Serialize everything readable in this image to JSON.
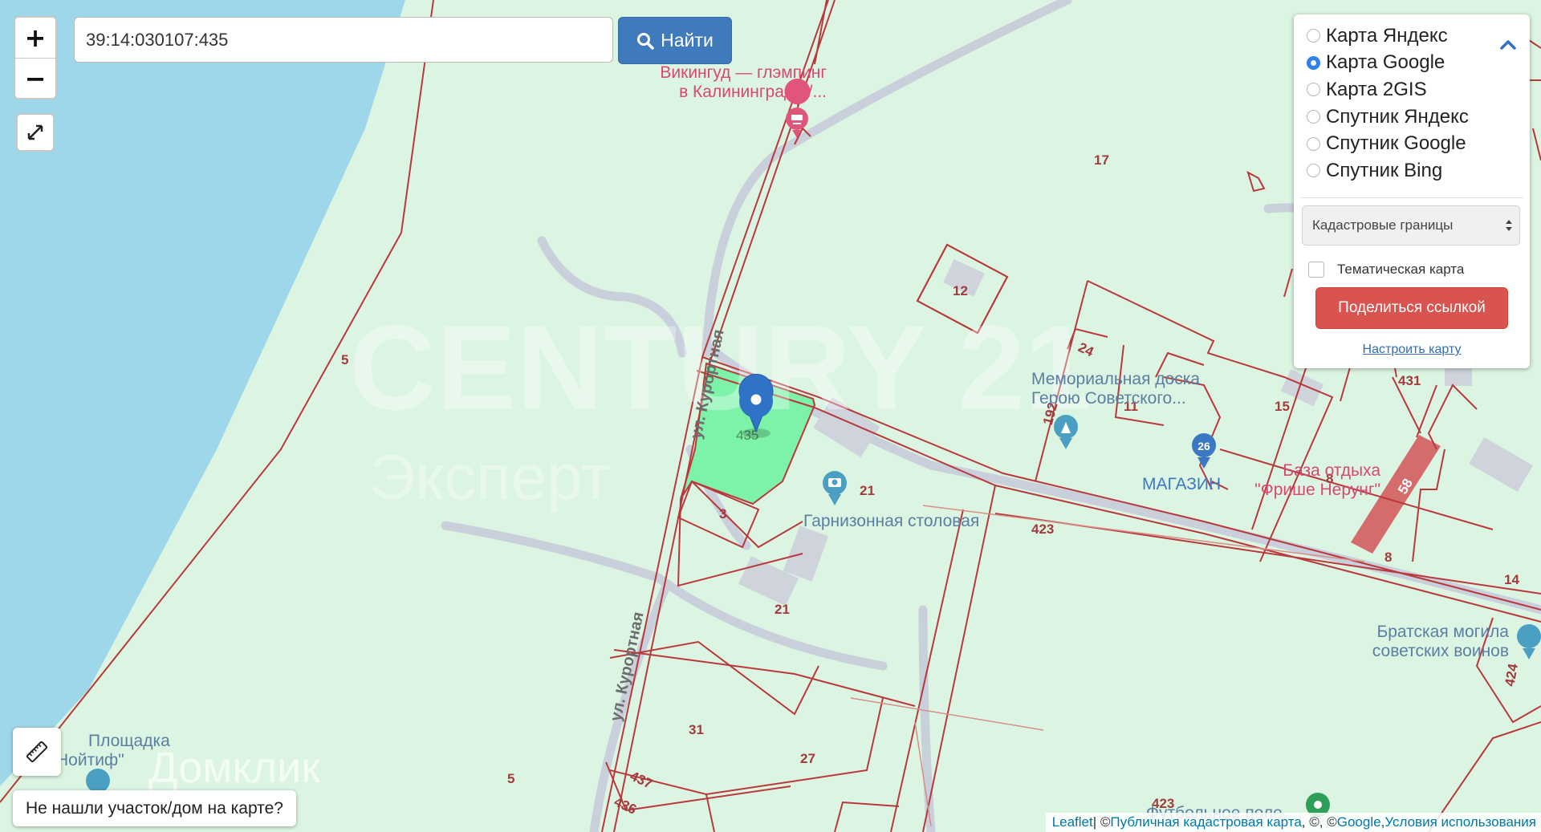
{
  "search": {
    "value": "39:14:030107:435",
    "button_label": "Найти"
  },
  "zoom": {
    "in_label": "+",
    "out_label": "−"
  },
  "layers": {
    "items": [
      {
        "label": "Карта Яндекс",
        "selected": false
      },
      {
        "label": "Карта Google",
        "selected": true
      },
      {
        "label": "Карта 2GIS",
        "selected": false
      },
      {
        "label": "Спутник Яндекс",
        "selected": false
      },
      {
        "label": "Спутник Google",
        "selected": false
      },
      {
        "label": "Спутник Bing",
        "selected": false
      }
    ],
    "overlay_select": "Кадастровые границы",
    "thematic_label": "Тематическая карта",
    "share_label": "Поделиться ссылкой",
    "configure_label": "Настроить карту"
  },
  "not_found_label": "Не нашли участок/дом на карте?",
  "attribution": {
    "leaflet": "Leaflet",
    "sep1": " | © ",
    "cadastral": "Публичная кадастровая карта",
    "sep2": ", ©, © ",
    "google": "Google",
    "sep3": ", ",
    "terms": "Условия использования"
  },
  "map": {
    "watermarks": [
      "CENTURY 21",
      "Эксперт",
      "Домклик"
    ],
    "parcel_numbers": [
      "5",
      "17",
      "12",
      "24",
      "11",
      "192",
      "26",
      "15",
      "431",
      "58",
      "8",
      "21",
      "3",
      "423",
      "21",
      "8",
      "14",
      "424",
      "31",
      "27",
      "437",
      "436",
      "5",
      "423",
      "435"
    ],
    "street_labels": [
      "ул. Курортная",
      "ул. Курортная"
    ],
    "poi": {
      "glamping": [
        "Викингуд — глэмпинг",
        "в Калининграде /..."
      ],
      "memorial": [
        "Мемориальная доска",
        "Герою Советского..."
      ],
      "shop": "МАГАЗИН",
      "resort": [
        "База отдыха",
        "\"Фрише Нерунг\""
      ],
      "canteen": "Гарнизонная столовая",
      "grave": [
        "Братская могила",
        "советских воинов"
      ],
      "playground": [
        "Площадка",
        "Нойтиф\""
      ],
      "football": "Футбольное поле"
    },
    "colors": {
      "water": "#9fd7ea",
      "land": "#dcf5e2",
      "parcel_line": "#b9393b",
      "highlight": "#7cf3a8",
      "marker": "#2f73c6"
    }
  }
}
